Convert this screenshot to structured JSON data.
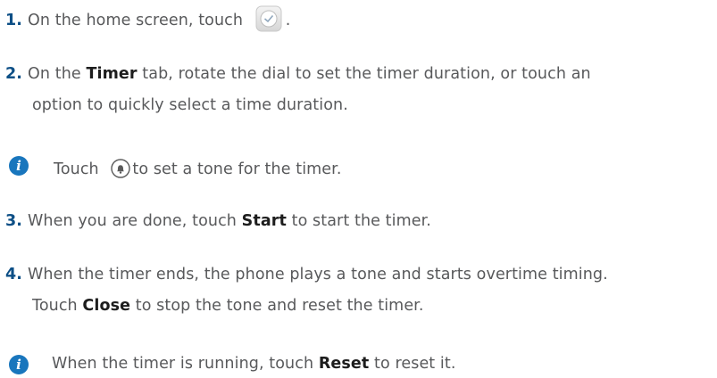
{
  "steps": {
    "s1": {
      "num": "1.",
      "text": "On the home screen, touch",
      "after": "."
    },
    "s2": {
      "num": "2.",
      "pre": "On the",
      "timer": "Timer",
      "post": "tab, rotate the dial to set the timer duration, or touch an",
      "line2": "option to quickly select a time duration."
    },
    "note1": {
      "pre": "Touch",
      "post": "to set a tone for the timer."
    },
    "s3": {
      "num": "3.",
      "pre": "When you are done, touch",
      "start": "Start",
      "post": "to start the timer."
    },
    "s4": {
      "num": "4.",
      "line1": "When the timer ends, the phone plays a tone and starts overtime timing.",
      "pre2": "Touch",
      "close": "Close",
      "post2": "to stop the tone and reset the timer."
    },
    "note2": {
      "pre": "When the timer is running, touch",
      "reset": "Reset",
      "post": "to reset it."
    }
  },
  "icons": {
    "clock": "clock-app-icon",
    "bell": "bell-icon",
    "info": "info-icon"
  },
  "colors": {
    "step_number": "#0d4f86",
    "info_icon": "#1976bd",
    "text": "#58595b"
  }
}
